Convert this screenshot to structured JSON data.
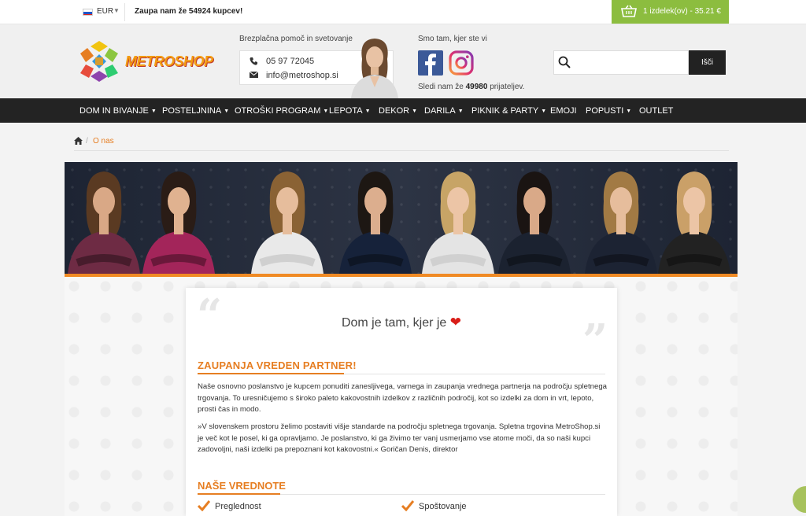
{
  "topbar": {
    "currency": "EUR",
    "trust_text": "Zaupa nam že 54924 kupcev!",
    "cart_text": "1 izdelek(ov) - 35.21 €"
  },
  "header": {
    "logo_text": "METROSHOP",
    "help_title": "Brezplačna pomoč in svetovanje",
    "phone": "05 97 72045",
    "email": "info@metroshop.si",
    "social_title": "Smo tam, kjer ste vi",
    "follow_prefix": "Sledi nam že",
    "follow_count": "49980",
    "follow_suffix": "prijateljev.",
    "search_placeholder": "",
    "search_button": "Išči"
  },
  "nav": {
    "items": [
      {
        "label": "DOM IN BIVANJE",
        "caret": "▼"
      },
      {
        "label": "POSTELJNINA",
        "caret": "▼"
      },
      {
        "label": "OTROŠKI PROGRAM",
        "caret": "▼"
      },
      {
        "label": "LEPOTA",
        "caret": "▼"
      },
      {
        "label": "DEKOR",
        "caret": "▼"
      },
      {
        "label": "DARILA",
        "caret": "▼"
      },
      {
        "label": "PIKNIK & PARTY",
        "caret": "▼"
      },
      {
        "label": "EMOJI",
        "caret": ""
      },
      {
        "label": "POPUSTI",
        "caret": "▼"
      },
      {
        "label": "OUTLET",
        "caret": ""
      }
    ]
  },
  "breadcrumb": {
    "separator": "/",
    "current": "O nas"
  },
  "content": {
    "motto": "Dom je tam, kjer je",
    "heart": "❤",
    "heading_partner": "ZAUPANJA VREDEN PARTNER!",
    "paragraph1": "Naše osnovno poslanstvo je kupcem ponuditi zanesljivega, varnega in zaupanja vrednega partnerja na področju spletnega trgovanja. To uresničujemo s široko paleto kakovostnih izdelkov z različnih področij, kot so izdelki za dom in vrt, lepoto, prosti čas in modo.",
    "paragraph2": "»V slovenskem prostoru želimo postaviti višje standarde na področju spletnega trgovanja. Spletna trgovina MetroShop.si je več kot le posel, ki ga opravljamo. Je poslanstvo, ki ga živimo ter vanj usmerjamo vse atome moči, da so naši kupci zadovoljni, naši izdelki pa prepoznani kot kakovostni.« Goričan Denis, direktor",
    "heading_values": "NAŠE VREDNOTE",
    "values": [
      "Preglednost",
      "Spoštovanje"
    ]
  },
  "colors": {
    "accent_orange": "#e67e22",
    "cart_green": "#8cbd3f",
    "nav_dark": "#232323",
    "facebook": "#3b5998"
  }
}
